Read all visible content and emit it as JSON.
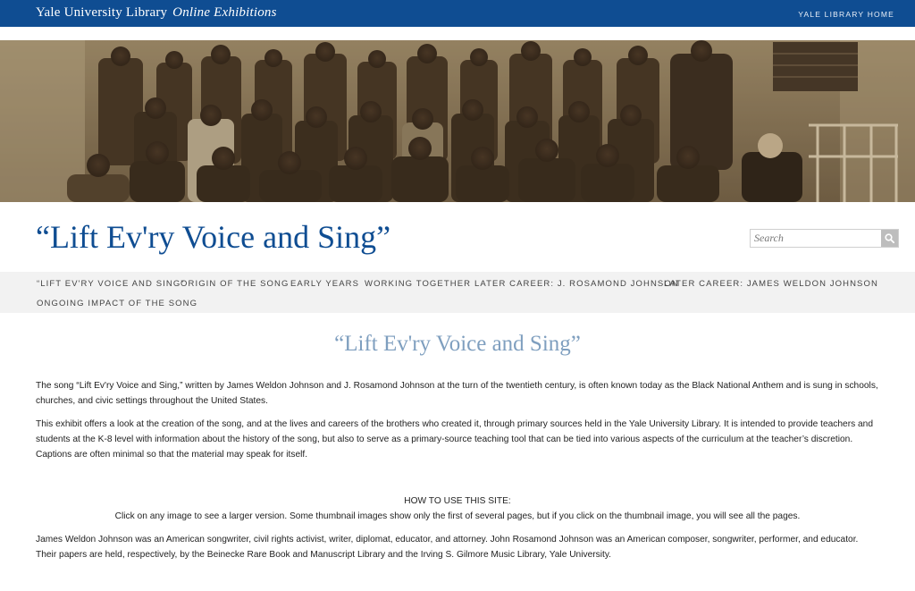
{
  "header": {
    "brand": "Yale University Library",
    "brand_sub": "Online Exhibitions",
    "home_link": "YALE LIBRARY HOME",
    "bar_color": "#0f4d92"
  },
  "banner": {
    "alt": "Historic sepia photograph of a group of schoolchildren and a teacher"
  },
  "site_title": "“Lift Ev'ry Voice and Sing”",
  "search": {
    "placeholder": "Search",
    "icon": "search-icon"
  },
  "nav": {
    "items": [
      {
        "label": "“Lift Ev'ry Voice and Sing”"
      },
      {
        "label": "Origin of the Song"
      },
      {
        "label": "Early Years"
      },
      {
        "label": "Working Together"
      },
      {
        "label": "Later Career: J. Rosamond Johnson"
      },
      {
        "label": "Later Career: James Weldon Johnson"
      },
      {
        "label": "Ongoing Impact of the Song"
      }
    ]
  },
  "main": {
    "heading": "“Lift Ev'ry Voice and Sing”",
    "para1": "The song “Lift Ev'ry Voice and Sing,” written by James Weldon Johnson and J. Rosamond Johnson at the turn of the twentieth century, is often known today as the Black National Anthem and is sung in schools, churches, and civic settings throughout the United States.",
    "para2": "This exhibit offers a look at the creation of the song, and at the lives and careers of the brothers who created it, through primary sources held in the Yale University Library. It is intended to provide teachers and students at the K-8 level with information about the history of the song, but also to serve as a primary-source teaching tool that can be tied into various aspects of the curriculum at the teacher’s discretion. Captions are often minimal so that the material may speak for itself.",
    "how_title": "HOW TO USE THIS SITE:",
    "how_text": "Click on any image to see a larger version. Some thumbnail images show only the first of several pages, but if you click on the thumbnail image, you will see all the pages.",
    "para3": "James Weldon Johnson was an American songwriter, civil rights activist, writer, diplomat, educator, and attorney. John Rosamond Johnson was an American composer, songwriter, performer, and educator. Their papers are held, respectively, by the Beinecke Rare Book and Manuscript Library and the Irving S. Gilmore Music Library, Yale University."
  },
  "colors": {
    "title": "#0f4d92",
    "heading": "#7f9fbf",
    "nav_bg": "#f2f2f2"
  }
}
